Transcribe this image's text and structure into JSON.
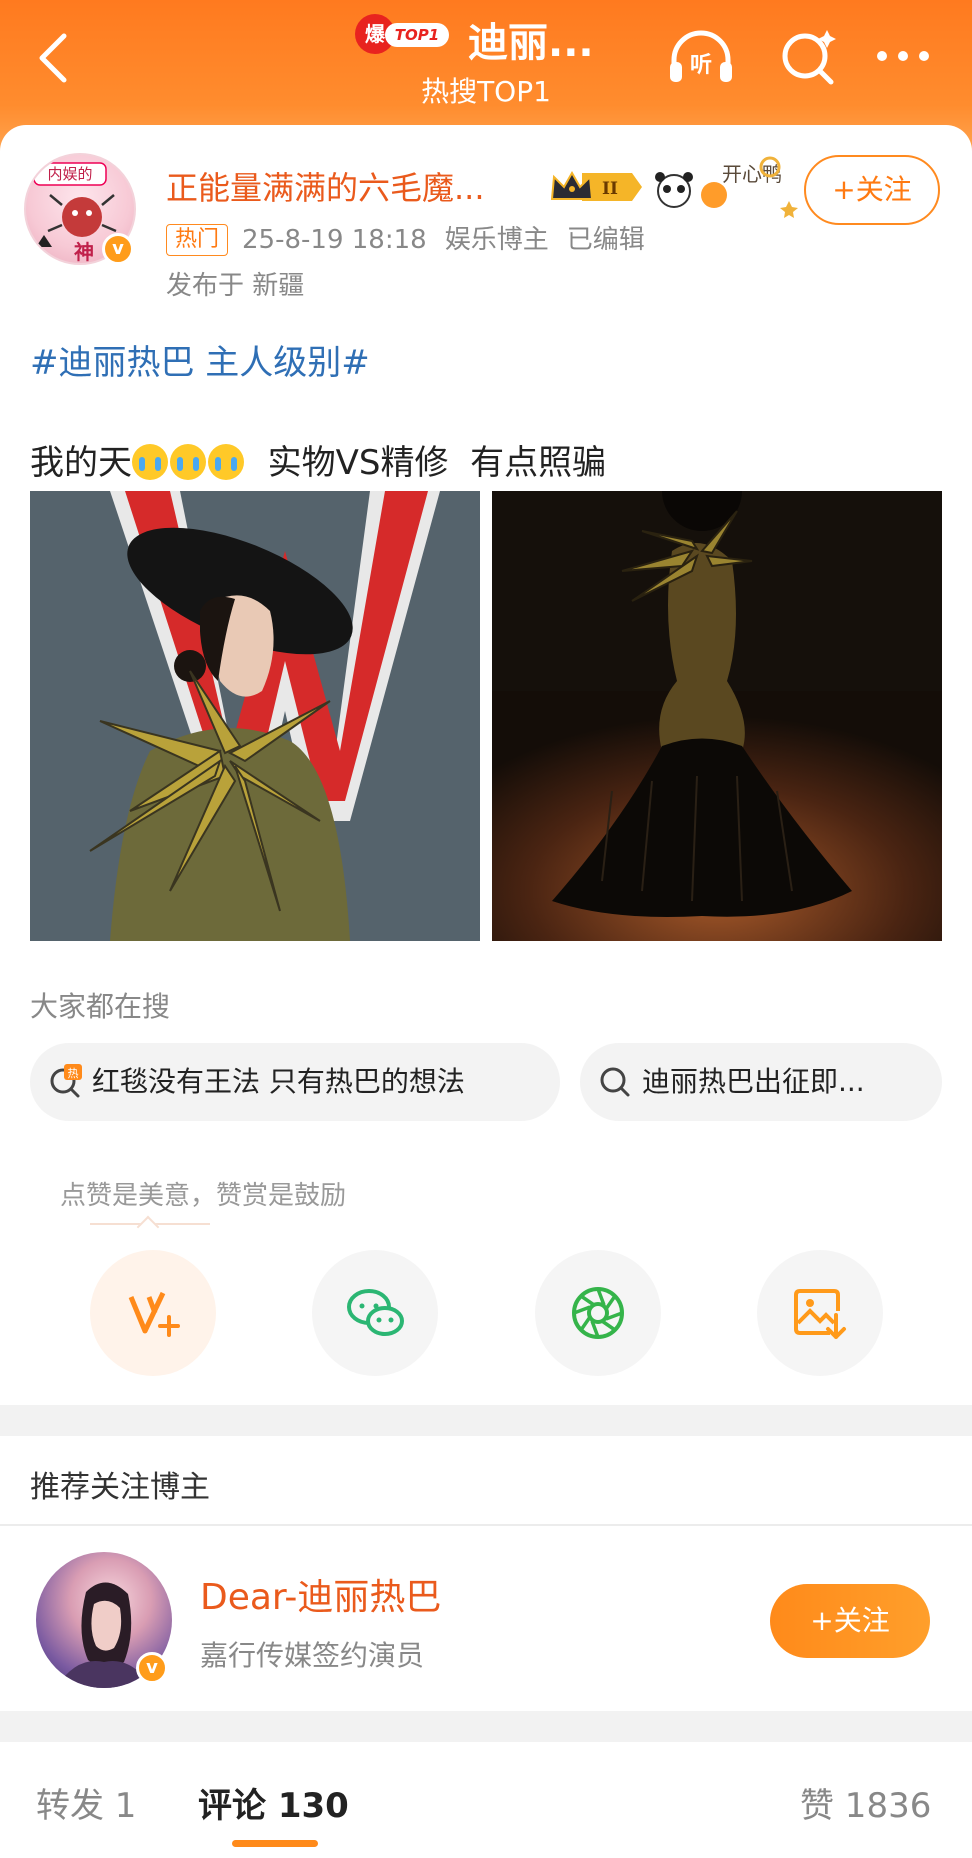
{
  "header": {
    "hot_badge_char": "爆",
    "hot_badge_label": "TOP1",
    "title": "迪丽...",
    "subtitle": "热搜TOP1",
    "listen_label": "听"
  },
  "post": {
    "author": "正能量满满的六毛魔...",
    "level": "II",
    "deco_text": "开心鸭",
    "follow_label": "+关注",
    "hot_tag": "热门",
    "time": "25-8-19 18:18",
    "role": "娱乐博主",
    "edited": "已编辑",
    "location": "发布于 新疆",
    "avatar_text_top": "内娱的",
    "avatar_text_bottom": "神",
    "topic": "#迪丽热巴 主人级别#",
    "text_before": "我的天",
    "text_after": "  实物VS精修  有点照骗"
  },
  "search": {
    "header": "大家都在搜",
    "items": [
      {
        "hot_mark": "热",
        "text": "红毯没有王法 只有热巴的想法"
      },
      {
        "text": "迪丽热巴出征即..."
      }
    ]
  },
  "share": {
    "tip": "点赞是美意，赞赏是鼓励",
    "buttons": [
      "vplus-icon",
      "wechat-icon",
      "moments-icon",
      "save-image-icon"
    ]
  },
  "recommend": {
    "title": "推荐关注博主",
    "name": "Dear-迪丽热巴",
    "desc": "嘉行传媒签约演员",
    "follow_label": "+关注"
  },
  "tabs": {
    "repost": "转发 1",
    "comment": "评论 130",
    "like": "赞 1836"
  },
  "colors": {
    "accent": "#ff8a1a",
    "author": "#ea5a1c",
    "topic": "#2f6fb5"
  }
}
